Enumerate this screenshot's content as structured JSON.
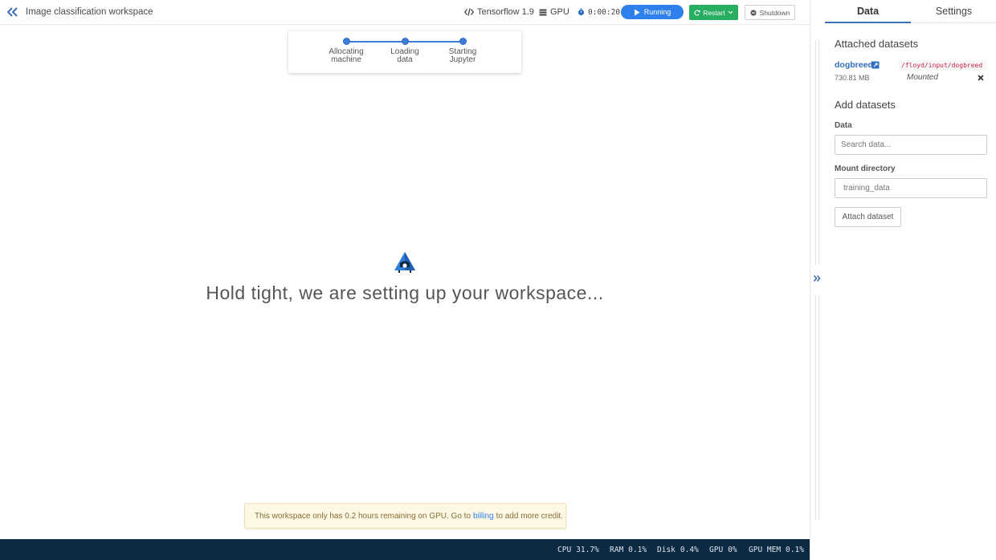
{
  "workspace": {
    "title": "Image classification workspace"
  },
  "toolbar": {
    "framework": "Tensorflow 1.9",
    "machine": "GPU",
    "timer": "0:00:20",
    "run_state": "Running",
    "restart_label": "Restart",
    "shutdown_label": "Shutdown"
  },
  "progress": {
    "steps": [
      {
        "line1": "Allocating",
        "line2": "machine"
      },
      {
        "line1": "Loading",
        "line2": "data"
      },
      {
        "line1": "Starting",
        "line2": "Jupyter"
      }
    ]
  },
  "main": {
    "message": "Hold tight, we are setting up your workspace..."
  },
  "warning": {
    "before": "This workspace only has 0.2 hours remaining on GPU. Go to",
    "link": "billing",
    "after": "to add more credit."
  },
  "metrics": [
    {
      "label": "CPU",
      "value": "31.7%"
    },
    {
      "label": "RAM",
      "value": "0.1%"
    },
    {
      "label": "Disk",
      "value": "0.4%"
    },
    {
      "label": "GPU",
      "value": "0%"
    },
    {
      "label": "GPU MEM",
      "value": "0.1%"
    }
  ],
  "panel": {
    "tabs": [
      {
        "label": "Data",
        "active": true
      },
      {
        "label": "Settings",
        "active": false
      }
    ],
    "attached_title": "Attached datasets",
    "dataset": {
      "name": "dogbreed",
      "path": "/floyd/input/dogbreed",
      "size": "730.81 MB",
      "status": "Mounted"
    },
    "add_title": "Add datasets",
    "data_label": "Data",
    "data_placeholder": "Search data...",
    "mount_label": "Mount directory",
    "mount_placeholder": "training_data",
    "attach_label": "Attach dataset"
  },
  "icons": {
    "collapse": "double-chevron-left-icon",
    "framework": "code-icon",
    "machine": "server-icon",
    "timer": "stopwatch-icon",
    "run": "play-icon",
    "restart": "refresh-icon",
    "shutdown": "power-icon",
    "logo": "floyd-logo-icon",
    "expand": "double-chevron-right-icon",
    "external_link": "external-link-icon",
    "remove": "close-icon"
  },
  "colors": {
    "primary": "#2f80ed",
    "success": "#27ae60",
    "footer": "#0d2a45",
    "warning_bg": "#fcf8e3",
    "link": "#2f6fbe"
  }
}
